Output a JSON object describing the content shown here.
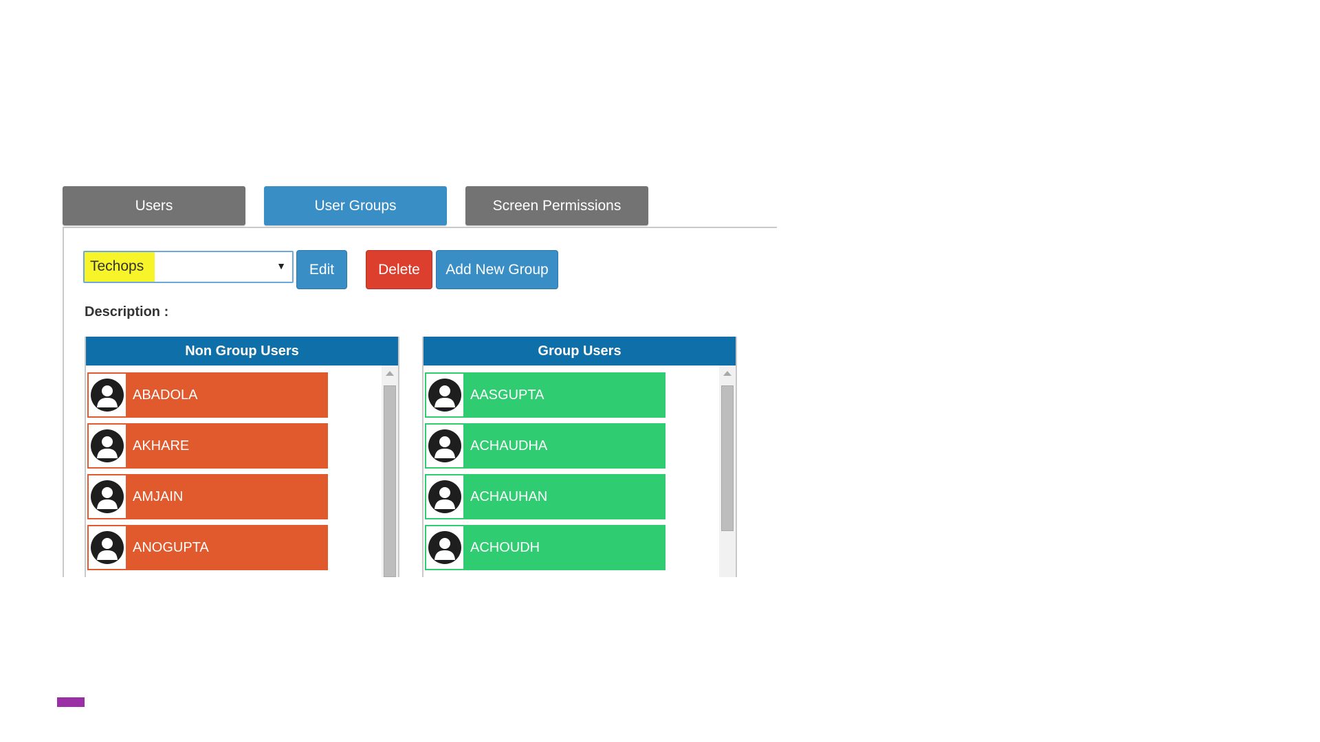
{
  "tabs": [
    {
      "label": "Users",
      "active": false
    },
    {
      "label": "User Groups",
      "active": true
    },
    {
      "label": "Screen Permissions",
      "active": false
    }
  ],
  "toolbar": {
    "group_select_value": "Techops",
    "edit_label": "Edit",
    "delete_label": "Delete",
    "add_label": "Add New Group"
  },
  "description_label": "Description :",
  "non_group_users": {
    "title": "Non Group Users",
    "users": [
      "ABADOLA",
      "AKHARE",
      "AMJAIN",
      "ANOGUPTA"
    ]
  },
  "group_users": {
    "title": "Group Users",
    "users": [
      "AASGUPTA",
      "ACHAUDHA",
      "ACHAUHAN",
      "ACHOUDH"
    ]
  },
  "colors": {
    "tab_active": "#3a8ec6",
    "tab_inactive": "#737373",
    "list_header": "#0f6fa8",
    "non_group_row": "#e05a2e",
    "group_row": "#2fcc71",
    "delete_button": "#dd3f2f",
    "select_highlight": "#f7f42a",
    "accent": "#9b2fa6"
  },
  "icons": {
    "avatar": "user-avatar-icon",
    "select_caret": "caret-down-icon",
    "scroll_up": "scroll-up-arrow-icon"
  }
}
